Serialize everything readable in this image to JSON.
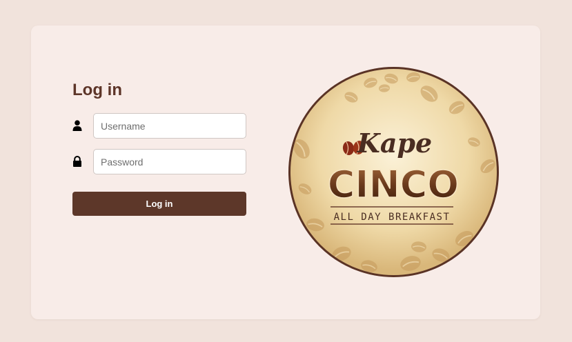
{
  "login": {
    "title": "Log in",
    "username_placeholder": "Username",
    "password_placeholder": "Password",
    "submit_label": "Log in"
  },
  "icons": {
    "username": "user-icon",
    "password": "lock-icon"
  },
  "logo": {
    "script_text": "Kape",
    "main_text": "CINCO",
    "tagline": "ALL DAY BREAKFAST"
  },
  "colors": {
    "page_bg": "#f1e3dc",
    "card_bg": "#f8ece8",
    "accent": "#5d3729",
    "title": "#5d3528"
  }
}
